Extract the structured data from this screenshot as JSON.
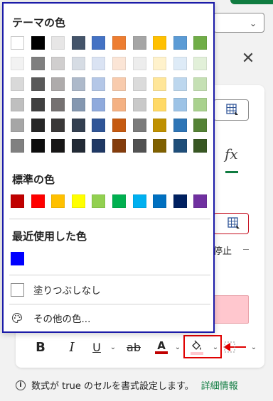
{
  "background": {
    "stop_text": "停止",
    "toolbar": {
      "bold": "B",
      "italic": "I",
      "underline": "U",
      "strikethrough": "ab",
      "font_color_letter": "A",
      "chevron": "⌄"
    },
    "info_text": "数式が true のセルを書式設定します。",
    "info_link": "詳細情報",
    "fx_symbol": "fx"
  },
  "picker": {
    "theme_title": "テーマの色",
    "theme_rows": [
      [
        "#ffffff",
        "#000000",
        "#e7e6e6",
        "#44546a",
        "#4472c4",
        "#ed7d31",
        "#a5a5a5",
        "#ffc000",
        "#5b9bd5",
        "#70ad47"
      ],
      [
        "#f2f2f2",
        "#7f7f7f",
        "#d0cece",
        "#d6dce4",
        "#dae3f3",
        "#fbe5d6",
        "#ededed",
        "#fff2cc",
        "#deebf7",
        "#e2f0d9"
      ],
      [
        "#d9d9d9",
        "#595959",
        "#aeabab",
        "#adb9ca",
        "#b4c7e7",
        "#f8cbad",
        "#dbdbdb",
        "#ffe699",
        "#bdd7ee",
        "#c5e0b4"
      ],
      [
        "#bfbfbf",
        "#404040",
        "#757171",
        "#8497b0",
        "#8faadc",
        "#f4b183",
        "#c9c9c9",
        "#ffd966",
        "#9dc3e6",
        "#a9d18e"
      ],
      [
        "#a6a6a6",
        "#262626",
        "#3a3838",
        "#333f50",
        "#2f5597",
        "#c55a11",
        "#7b7b7b",
        "#bf9000",
        "#2e75b6",
        "#548235"
      ],
      [
        "#808080",
        "#0d0d0d",
        "#171616",
        "#222a35",
        "#1f3864",
        "#843c0c",
        "#525252",
        "#7f6000",
        "#1f4e79",
        "#385723"
      ]
    ],
    "standard_title": "標準の色",
    "standard_colors": [
      "#c00000",
      "#ff0000",
      "#ffc000",
      "#ffff00",
      "#92d050",
      "#00b050",
      "#00b0f0",
      "#0070c0",
      "#002060",
      "#7030a0"
    ],
    "recent_title": "最近使用した色",
    "recent_colors": [
      "#0000ff"
    ],
    "no_fill_label": "塗りつぶしなし",
    "more_colors_label": "その他の色..."
  }
}
